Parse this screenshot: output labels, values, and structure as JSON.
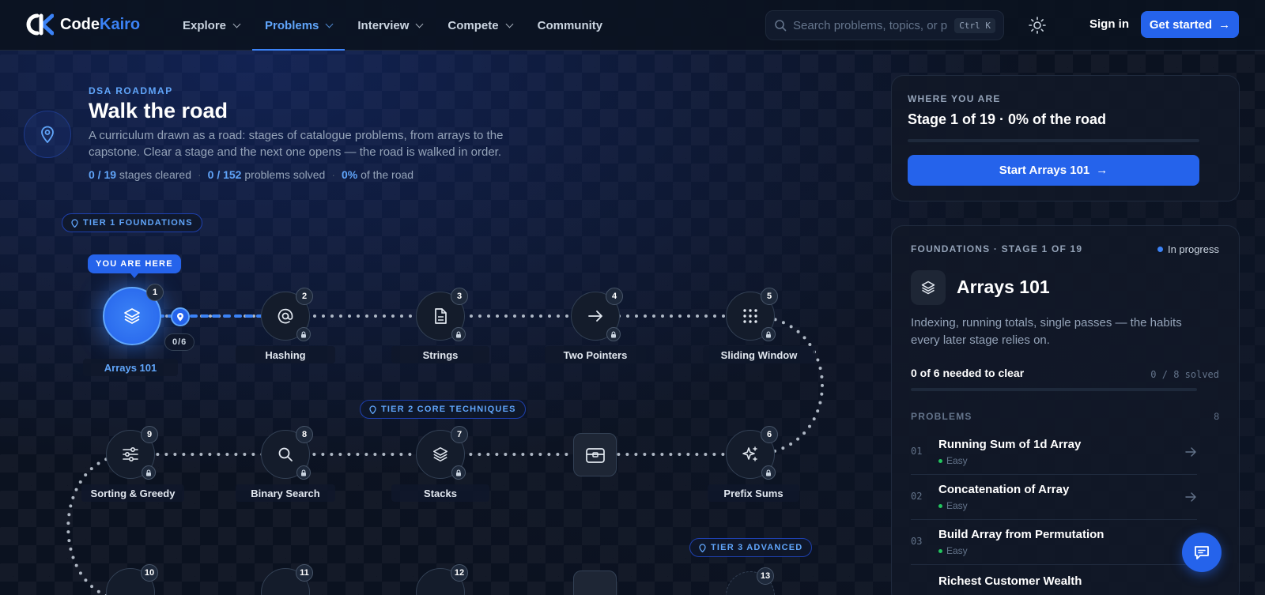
{
  "brand": {
    "name_part1": "Code",
    "name_part2": "Kairo"
  },
  "nav": {
    "items": [
      {
        "label": "Explore",
        "dropdown": true
      },
      {
        "label": "Problems",
        "dropdown": true,
        "active": true
      },
      {
        "label": "Interview",
        "dropdown": true
      },
      {
        "label": "Compete",
        "dropdown": true
      },
      {
        "label": "Community",
        "dropdown": false
      }
    ],
    "search_placeholder": "Search problems, topics, or p...",
    "search_shortcut": "Ctrl K",
    "signin": "Sign in",
    "get_started": "Get started"
  },
  "intro": {
    "eyebrow": "DSA ROADMAP",
    "title": "Walk the road",
    "description": "A curriculum drawn as a road: stages of catalogue problems, from arrays to the capstone. Clear a stage and the next one opens — the road is walked in order.",
    "stats": {
      "stages": "0 / 19",
      "stages_label": "stages cleared",
      "problems": "0 / 152",
      "problems_label": "problems solved",
      "road": "0%",
      "road_label": "of the road"
    }
  },
  "road": {
    "tiers": [
      "TIER 1 FOUNDATIONS",
      "TIER 2 CORE TECHNIQUES",
      "TIER 3 ADVANCED"
    ],
    "you_are_here": "YOU ARE HERE",
    "current_count": "0/6",
    "nodes": [
      {
        "num": "1",
        "label": "Arrays 101",
        "icon": "layers-icon",
        "active": true
      },
      {
        "num": "2",
        "label": "Hashing",
        "icon": "at-icon"
      },
      {
        "num": "3",
        "label": "Strings",
        "icon": "document-icon"
      },
      {
        "num": "4",
        "label": "Two Pointers",
        "icon": "arrow-right-icon"
      },
      {
        "num": "5",
        "label": "Sliding Window",
        "icon": "grid-dots-icon"
      },
      {
        "num": "6",
        "label": "Prefix Sums",
        "icon": "sparkle-icon"
      },
      {
        "num": "7",
        "label": "Stacks",
        "icon": "layers-icon"
      },
      {
        "num": "8",
        "label": "Binary Search",
        "icon": "search-icon"
      },
      {
        "num": "9",
        "label": "Sorting & Greedy",
        "icon": "sliders-icon"
      },
      {
        "num": "10",
        "label": "",
        "icon": ""
      },
      {
        "num": "11",
        "label": "",
        "icon": ""
      },
      {
        "num": "12",
        "label": "",
        "icon": ""
      },
      {
        "num": "13",
        "label": "",
        "icon": ""
      }
    ]
  },
  "where": {
    "eyebrow": "WHERE YOU ARE",
    "title": "Stage 1 of 19 · 0% of the road",
    "progress": 0,
    "button": "Start Arrays 101"
  },
  "stage": {
    "eyebrow": "FOUNDATIONS · STAGE 1 OF 19",
    "status": "In progress",
    "name": "Arrays 101",
    "description": "Indexing, running totals, single passes — the habits every later stage relies on.",
    "needed": "0 of 6 needed to clear",
    "solved": "0 / 8 solved",
    "progress": 0,
    "problems_header": "PROBLEMS",
    "problems_count": "8",
    "problems": [
      {
        "num": "01",
        "title": "Running Sum of 1d Array",
        "difficulty": "Easy"
      },
      {
        "num": "02",
        "title": "Concatenation of Array",
        "difficulty": "Easy"
      },
      {
        "num": "03",
        "title": "Build Array from Permutation",
        "difficulty": "Easy"
      },
      {
        "num": "",
        "title": "Richest Customer Wealth",
        "difficulty": ""
      }
    ]
  },
  "colors": {
    "accent": "#2563eb",
    "accent_light": "#60a5fa",
    "easy": "#22c55e",
    "background": "#0b1220"
  }
}
